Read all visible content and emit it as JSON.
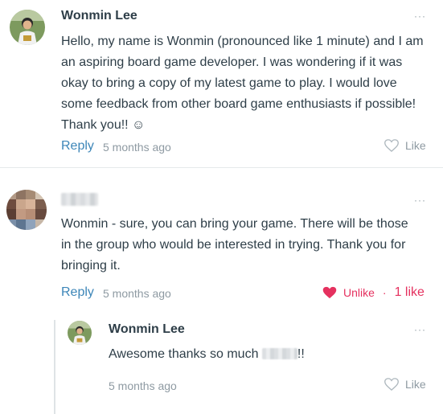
{
  "comments": [
    {
      "author": "Wonmin Lee",
      "text": "Hello, my name is Wonmin (pronounced like 1 minute) and I am an aspiring board game developer. I was wondering if it was okay to bring a copy of my latest game to play. I would love some feedback from other board game enthusiasts if possible! Thank you!! ☺",
      "reply_label": "Reply",
      "time": "5 months ago",
      "like_label": "Like",
      "more_label": "···"
    },
    {
      "author": "",
      "text": "Wonmin - sure, you can bring your game. There will be those in the group who would be interested in trying. Thank you for bringing it.",
      "reply_label": "Reply",
      "time": "5 months ago",
      "unlike_label": "Unlike",
      "separator": "·",
      "like_count": "1 like",
      "more_label": "···",
      "liked_color": "#e5315f"
    }
  ],
  "reply": {
    "author": "Wonmin Lee",
    "text_before": "Awesome thanks so much ",
    "text_after": "!!",
    "time": "5 months ago",
    "like_label": "Like",
    "more_label": "···"
  },
  "colors": {
    "link": "#3d86b8",
    "muted": "#8e9aa2",
    "text": "#2e3e48"
  }
}
